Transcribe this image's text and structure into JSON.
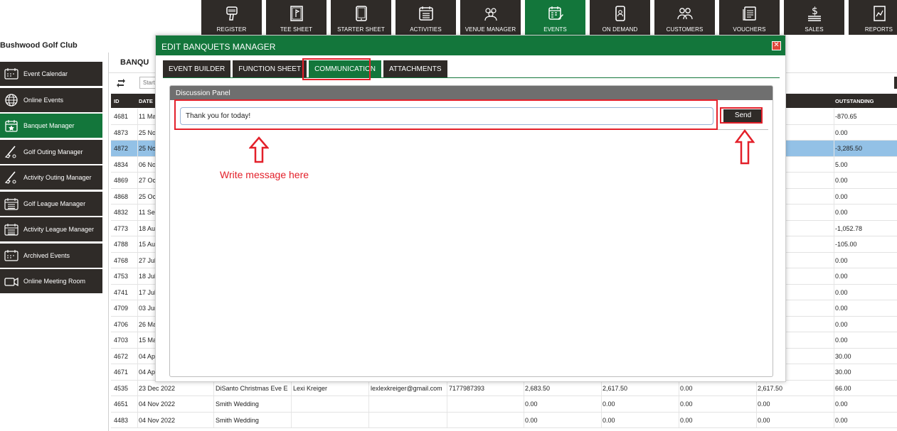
{
  "club_name": "Bushwood Golf Club",
  "nav": [
    {
      "label": "REGISTER",
      "icon": "barcode-scanner-icon"
    },
    {
      "label": "TEE SHEET",
      "icon": "tee-sheet-icon"
    },
    {
      "label": "STARTER SHEET",
      "icon": "tablet-icon"
    },
    {
      "label": "ACTIVITIES",
      "icon": "calendar-list-icon"
    },
    {
      "label": "VENUE MANAGER",
      "icon": "group-icon"
    },
    {
      "label": "EVENTS",
      "icon": "calendar-edit-icon",
      "active": true
    },
    {
      "label": "ON DEMAND",
      "icon": "phone-user-icon"
    },
    {
      "label": "CUSTOMERS",
      "icon": "customers-icon"
    },
    {
      "label": "VOUCHERS",
      "icon": "vouchers-icon"
    },
    {
      "label": "SALES",
      "icon": "cash-icon"
    },
    {
      "label": "REPORTS",
      "icon": "report-icon"
    }
  ],
  "sidebar": [
    {
      "label": "Event Calendar",
      "icon": "calendar-icon"
    },
    {
      "label": "Online Events",
      "icon": "globe-icon"
    },
    {
      "label": "Banquet Manager",
      "icon": "banquet-calendar-icon",
      "active": true
    },
    {
      "label": "Golf Outing Manager",
      "icon": "golf-club-icon"
    },
    {
      "label": "Activity Outing Manager",
      "icon": "golf-club-icon"
    },
    {
      "label": "Golf League Manager",
      "icon": "list-calendar-icon"
    },
    {
      "label": "Activity League Manager",
      "icon": "list-calendar-icon"
    },
    {
      "label": "Archived Events",
      "icon": "archive-calendar-icon"
    },
    {
      "label": "Online Meeting Room",
      "icon": "video-camera-icon"
    }
  ],
  "main": {
    "title": "BANQU",
    "start_placeholder": "Start",
    "columns": {
      "id": "ID",
      "date": "DATE",
      "outstanding": "OUTSTANDING"
    },
    "rows": [
      {
        "id": "4681",
        "date": "11 Ma",
        "out": "-870.65"
      },
      {
        "id": "4873",
        "date": "25 No",
        "out": "0.00"
      },
      {
        "id": "4872",
        "date": "25 No",
        "out": "-3,285.50",
        "selected": true
      },
      {
        "id": "4834",
        "date": "06 No",
        "out": "5.00"
      },
      {
        "id": "4869",
        "date": "27 Oc",
        "out": "0.00"
      },
      {
        "id": "4868",
        "date": "25 Oc",
        "out": "0.00"
      },
      {
        "id": "4832",
        "date": "11 Se",
        "out": "0.00"
      },
      {
        "id": "4773",
        "date": "18 Au",
        "out": "-1,052.78"
      },
      {
        "id": "4788",
        "date": "15 Au",
        "out": "-105.00"
      },
      {
        "id": "4768",
        "date": "27 Jul",
        "out": "0.00"
      },
      {
        "id": "4753",
        "date": "18 Jul",
        "out": "0.00"
      },
      {
        "id": "4741",
        "date": "17 Jul",
        "out": "0.00"
      },
      {
        "id": "4709",
        "date": "03 Jun",
        "out": "0.00"
      },
      {
        "id": "4706",
        "date": "26 Ma",
        "out": "0.00"
      },
      {
        "id": "4703",
        "date": "15 Ma",
        "out": "0.00"
      },
      {
        "id": "4672",
        "date": "04 Ap",
        "out": "30.00"
      },
      {
        "id": "4671",
        "date": "04 Ap",
        "out": "30.00"
      },
      {
        "id": "4535",
        "date": "23 Dec 2022",
        "name": "DiSanto Christmas Eve E",
        "contact": "Lexi Kreiger",
        "email": "lexlexkreiger@gmail.com",
        "phone": "7177987393",
        "total": "2,683.50",
        "paid": "2,617.50",
        "disc": "0.00",
        "bal": "2,617.50",
        "out": "66.00"
      },
      {
        "id": "4651",
        "date": "04 Nov 2022",
        "name": "Smith Wedding",
        "contact": "",
        "email": "",
        "phone": "",
        "total": "0.00",
        "paid": "0.00",
        "disc": "0.00",
        "bal": "0.00",
        "out": "0.00"
      },
      {
        "id": "4483",
        "date": "04 Nov 2022",
        "name": "Smith Wedding",
        "contact": "",
        "email": "",
        "phone": "",
        "total": "0.00",
        "paid": "0.00",
        "disc": "0.00",
        "bal": "0.00",
        "out": "0.00"
      }
    ]
  },
  "modal": {
    "title": "EDIT BANQUETS MANAGER",
    "close": "✕",
    "tabs": [
      {
        "label": "EVENT BUILDER"
      },
      {
        "label": "FUNCTION SHEET"
      },
      {
        "label": "COMMUNICATION",
        "active": true
      },
      {
        "label": "ATTACHMENTS"
      }
    ],
    "panel_title": "Discussion Panel",
    "message_value": "Thank you for today!",
    "send_label": "Send",
    "hint": "Write message here"
  },
  "colors": {
    "dark": "#2f2b28",
    "green": "#13763b",
    "highlight": "#e3202a",
    "selected_row": "#93c1e6"
  }
}
